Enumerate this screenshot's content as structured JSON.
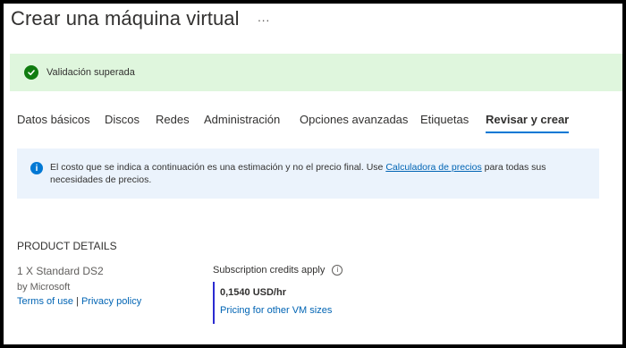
{
  "header": {
    "title": "Crear una máquina virtual",
    "more_label": "···"
  },
  "banner": {
    "text": "Validación superada",
    "status_color": "#107c10"
  },
  "tabs": [
    {
      "label": "Datos básicos"
    },
    {
      "label": "Discos"
    },
    {
      "label": "Redes"
    },
    {
      "label": "Administración"
    },
    {
      "label": "Opciones avanzadas"
    },
    {
      "label": "Etiquetas"
    },
    {
      "label": "Revisar y crear",
      "active": true
    }
  ],
  "info": {
    "icon": "info-icon",
    "text_before": "El costo que se indica a continuación es una estimación y no el precio final. Use",
    "link": "Calculadora de precios",
    "text_after": "para todas sus necesidades de precios."
  },
  "product": {
    "section_title": "PRODUCT DETAILS",
    "name": "1 X Standard DS2",
    "publisher": "by Microsoft",
    "terms_link": "Terms of use",
    "separator": "|",
    "privacy_link": "Privacy policy",
    "credits_label": "Subscription credits apply",
    "price": "0,1540 USD/hr",
    "pricing_link": "Pricing for other VM sizes"
  },
  "colors": {
    "accent": "#0078d4",
    "link": "#0064b4",
    "success_bg": "#dff6dd",
    "info_bg": "#ebf3fc"
  }
}
